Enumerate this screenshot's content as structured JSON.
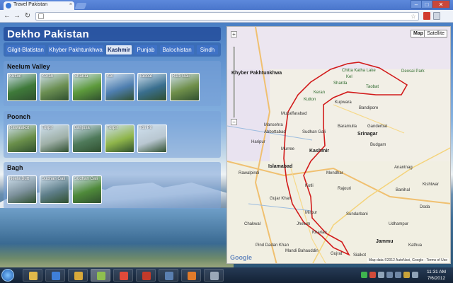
{
  "browser": {
    "tab_title": "Travel Pakistan",
    "tab_close": "×",
    "url": "",
    "window_controls": [
      "–",
      "□",
      "✕"
    ]
  },
  "site": {
    "title": "Dekho Pakistan",
    "nav": [
      {
        "label": "Gilgit-Blatistan"
      },
      {
        "label": "Khyber Pakhtunkhwa"
      },
      {
        "label": "Kashmir"
      },
      {
        "label": "Punjab"
      },
      {
        "label": "Balochistan"
      },
      {
        "label": "Sindh"
      }
    ],
    "active_nav": "Kashmir",
    "sections": [
      {
        "title": "Neelum Valley",
        "thumbs": [
          {
            "caption": "Kutton",
            "color": "#3f7a3a"
          },
          {
            "caption": "Keran",
            "color": "#6b8f52"
          },
          {
            "caption": "Sharda",
            "color": "#5d9a3c"
          },
          {
            "caption": "Kel",
            "color": "#4f7fb0"
          },
          {
            "caption": "Taobat",
            "color": "#3a6f8f"
          },
          {
            "caption": "Ratti Gali",
            "color": "#6f8f4a"
          }
        ]
      },
      {
        "title": "Poonch",
        "thumbs": [
          {
            "caption": "Rawalakot",
            "color": "#6a8f4a"
          },
          {
            "caption": "Tolipir",
            "color": "#9fb0a8"
          },
          {
            "caption": "Banjosa",
            "color": "#4f7a5a"
          },
          {
            "caption": "Tolipir",
            "color": "#8fb54a"
          },
          {
            "caption": "Toli Pir",
            "color": "#b9c7d1"
          }
        ]
      },
      {
        "title": "Bagh",
        "thumbs": [
          {
            "caption": "Neela Butt",
            "color": "#7f939e"
          },
          {
            "caption": "Sudhan Gali",
            "color": "#5f7f8a"
          },
          {
            "caption": "Sudhan Gali",
            "color": "#4f8a3a"
          }
        ]
      }
    ]
  },
  "map": {
    "type_buttons": [
      "Map",
      "Satellite"
    ],
    "selected_type": "Map",
    "zoom_in": "+",
    "zoom_out": "−",
    "region_label": "Kashmir",
    "labels": [
      {
        "text": "Khyber Pakhtunkhwa",
        "cls": "big"
      },
      {
        "text": "Chitta Katha Lake",
        "cls": "park"
      },
      {
        "text": "Kel",
        "cls": "park"
      },
      {
        "text": "Sharda",
        "cls": "park"
      },
      {
        "text": "Taobat",
        "cls": "park"
      },
      {
        "text": "Keran",
        "cls": "park"
      },
      {
        "text": "Kutton",
        "cls": "park"
      },
      {
        "text": "Deosai Park",
        "cls": "park"
      },
      {
        "text": "Mansehra",
        "cls": ""
      },
      {
        "text": "Abbottabad",
        "cls": ""
      },
      {
        "text": "Muzaffarabad",
        "cls": ""
      },
      {
        "text": "Haripur",
        "cls": ""
      },
      {
        "text": "Murree",
        "cls": ""
      },
      {
        "text": "Islamabad",
        "cls": "big"
      },
      {
        "text": "Rawalpindi",
        "cls": ""
      },
      {
        "text": "Sudhan Gali",
        "cls": ""
      },
      {
        "text": "Baramulla",
        "cls": ""
      },
      {
        "text": "Srinagar",
        "cls": "big"
      },
      {
        "text": "Kupwara",
        "cls": ""
      },
      {
        "text": "Bandipore",
        "cls": ""
      },
      {
        "text": "Ganderbal",
        "cls": ""
      },
      {
        "text": "Budgam",
        "cls": ""
      },
      {
        "text": "Anantnag",
        "cls": ""
      },
      {
        "text": "Banihal",
        "cls": ""
      },
      {
        "text": "Kashmir",
        "cls": "big"
      },
      {
        "text": "Rajouri",
        "cls": ""
      },
      {
        "text": "Mendhar",
        "cls": ""
      },
      {
        "text": "Kotli",
        "cls": ""
      },
      {
        "text": "Sundarbani",
        "cls": ""
      },
      {
        "text": "Mirpur",
        "cls": ""
      },
      {
        "text": "Jhelum",
        "cls": ""
      },
      {
        "text": "Kharian",
        "cls": ""
      },
      {
        "text": "Gujar Khan",
        "cls": ""
      },
      {
        "text": "Chakwal",
        "cls": ""
      },
      {
        "text": "Jammu",
        "cls": "big"
      },
      {
        "text": "Udhampur",
        "cls": ""
      },
      {
        "text": "Kathua",
        "cls": ""
      },
      {
        "text": "Sialkot",
        "cls": ""
      },
      {
        "text": "Gujrat",
        "cls": ""
      },
      {
        "text": "Pind Dadan Khan",
        "cls": ""
      },
      {
        "text": "Mandi Bahauddin",
        "cls": ""
      },
      {
        "text": "Doda",
        "cls": ""
      },
      {
        "text": "Kishtwar",
        "cls": ""
      }
    ],
    "brand": "Google",
    "copyright": "Map data ©2012 AutoNavi, Google - Terms of Use"
  },
  "taskbar": {
    "apps": [
      {
        "name": "explorer",
        "color": "#e0b84a"
      },
      {
        "name": "media",
        "color": "#3f7fd8"
      },
      {
        "name": "folder",
        "color": "#d9a93a"
      },
      {
        "name": "editor",
        "color": "#8fbf4f"
      },
      {
        "name": "chrome",
        "color": "#e04a3a"
      },
      {
        "name": "filezilla",
        "color": "#c23a2a"
      },
      {
        "name": "network",
        "color": "#5a7fb0"
      },
      {
        "name": "firefox",
        "color": "#e07a2a"
      },
      {
        "name": "tool",
        "color": "#9aa8b8"
      }
    ],
    "time": "11:31 AM",
    "date": "7/6/2012"
  }
}
